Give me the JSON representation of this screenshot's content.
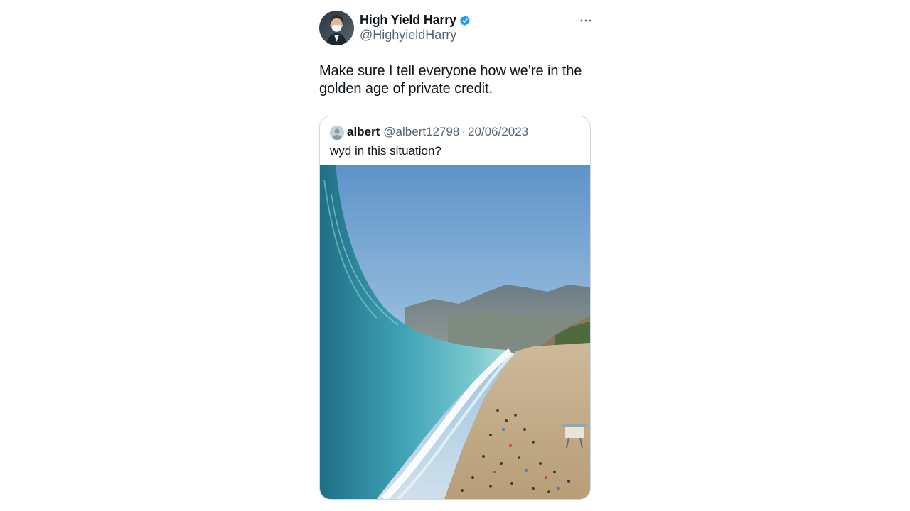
{
  "tweet": {
    "author_name": "High Yield Harry",
    "author_handle": "@HighyieldHarry",
    "text": "Make sure I tell everyone how we’re in the golden age of private credit.",
    "verified_icon": "verified-badge-icon",
    "more_icon": "more-horizontal-icon"
  },
  "quote": {
    "author_name": "albert",
    "author_handle": "@albert12798",
    "separator": "·",
    "date": "20/06/2023",
    "text": "wyd in this situation?",
    "image_subject": "giant wave over a crowded beach"
  },
  "colors": {
    "text": "#0f1419",
    "secondary_text": "#536471",
    "border": "#cfd9de",
    "verified": "#1d9bf0"
  }
}
